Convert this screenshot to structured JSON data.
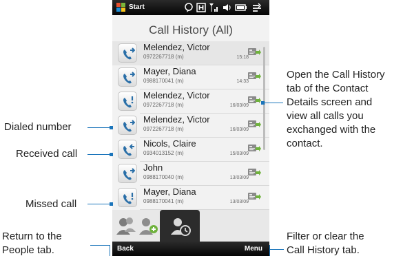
{
  "status_bar": {
    "start_label": "Start",
    "icons": [
      "windows-logo",
      "chat-icon",
      "h-data-icon",
      "signal-icon",
      "speaker-icon",
      "battery-icon",
      "connectivity-icon"
    ]
  },
  "screen_title": "Call History (All)",
  "calls": [
    {
      "name": "Melendez, Victor",
      "number": "0972267718 (m)",
      "time": "15:18",
      "type": "dialed"
    },
    {
      "name": "Mayer, Diana",
      "number": "0988170041 (m)",
      "time": "14:33",
      "type": "dialed"
    },
    {
      "name": "Melendez, Victor",
      "number": "0972267718 (m)",
      "time": "16/03/09",
      "type": "missed"
    },
    {
      "name": "Melendez, Victor",
      "number": "0972267718 (m)",
      "time": "16/03/09",
      "type": "dialed"
    },
    {
      "name": "Nicols, Claire",
      "number": "0934013152 (m)",
      "time": "15/03/09",
      "type": "received"
    },
    {
      "name": "John",
      "number": "0988170040 (m)",
      "time": "13/03/09",
      "type": "dialed"
    },
    {
      "name": "Mayer, Diana",
      "number": "0988170041 (m)",
      "time": "13/03/09",
      "type": "missed"
    }
  ],
  "softkeys": {
    "left": "Back",
    "right": "Menu"
  },
  "callouts": {
    "dialed": "Dialed number",
    "received": "Received call",
    "missed": "Missed call",
    "people_tab": [
      "Return to the",
      "People tab."
    ],
    "call_history_tab": [
      "Open the Call History",
      "tab of the Contact",
      "Details screen and",
      "view all calls you",
      "exchanged with the",
      "contact."
    ],
    "menu": [
      "Filter or clear the",
      "Call History tab."
    ]
  },
  "colors": {
    "accent": "#1b75bb",
    "dialed_icon": "#2a6fa8",
    "missed_icon": "#2a6fa8"
  }
}
